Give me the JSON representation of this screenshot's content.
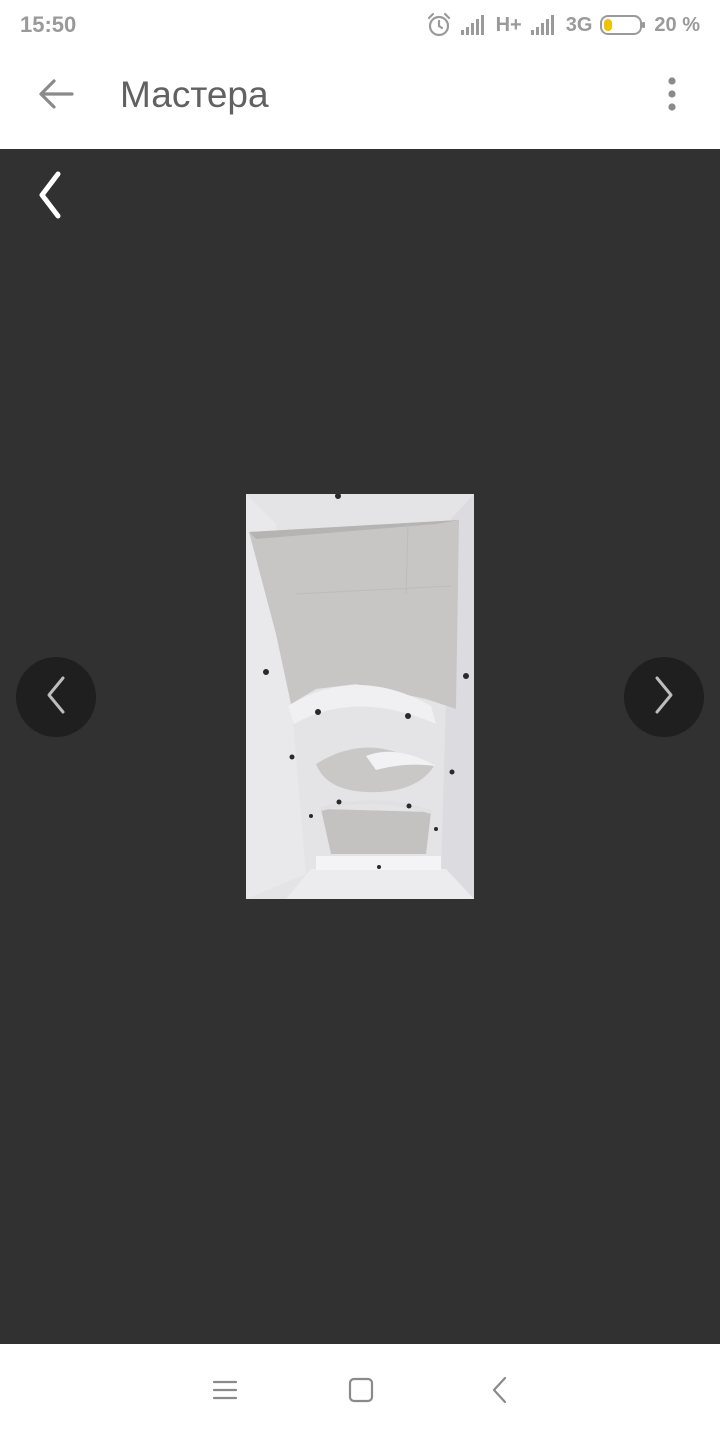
{
  "status_bar": {
    "time": "15:50",
    "network_1": "H+",
    "network_2": "3G",
    "battery_percent": "20 %",
    "battery_level": 0.2,
    "icons": [
      "alarm-icon",
      "signal-icon",
      "signal-icon",
      "battery-icon"
    ]
  },
  "app_bar": {
    "title": "Мастера",
    "icons": [
      "back-arrow-icon",
      "overflow-menu-icon"
    ]
  },
  "viewer": {
    "background": "#313131",
    "photo_description_icon": "ceiling-photo",
    "icons": [
      "chevron-left-icon",
      "chevron-left-icon",
      "chevron-right-icon"
    ]
  },
  "system_nav": {
    "icons": [
      "menu-icon",
      "home-square-icon",
      "back-chevron-icon"
    ]
  }
}
